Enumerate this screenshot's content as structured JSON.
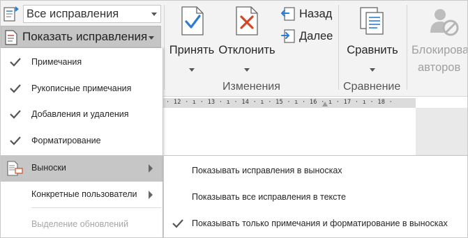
{
  "ribbon": {
    "markup_combo": {
      "value": "Все исправления"
    },
    "show_markup_button": {
      "label": "Показать исправления"
    },
    "accept_button": {
      "label": "Принять"
    },
    "reject_button": {
      "label": "Отклонить"
    },
    "previous_button": {
      "label": "Назад"
    },
    "next_button": {
      "label": "Далее"
    },
    "compare_button": {
      "label": "Сравнить"
    },
    "block_authors_button": {
      "label_line1": "Блокирова",
      "label_line2": "авторов"
    },
    "groups": {
      "changes": "Изменения",
      "compare": "Сравнение"
    }
  },
  "ruler": {
    "text": "· 12 · ı · 13 · ı · 14 · ı · 15 · ı · 16 · ı · 17 · ı · 18 ·"
  },
  "menu": {
    "items": [
      {
        "label": "Примечания",
        "checked": true
      },
      {
        "label": "Рукописные примечания",
        "checked": true
      },
      {
        "label": "Добавления и удаления",
        "checked": true
      },
      {
        "label": "Форматирование",
        "checked": true
      },
      {
        "label": "Выноски",
        "checked": false,
        "highlighted": true,
        "submenu": true,
        "icon": "balloons-icon"
      },
      {
        "label": "Конкретные пользователи",
        "checked": false,
        "submenu": true
      },
      {
        "label": "Выделение обновлений",
        "checked": false,
        "disabled": true
      }
    ]
  },
  "submenu": {
    "items": [
      {
        "label": "Показывать исправления в выносках",
        "checked": false
      },
      {
        "label": "Показывать все исправления в тексте",
        "checked": false
      },
      {
        "label": "Показывать только примечания и форматирование в выносках",
        "checked": true
      }
    ]
  },
  "colors": {
    "accent_blue": "#2b7cd3",
    "reject_red": "#d24726",
    "highlight_gray": "#c6c6c6",
    "ribbon_bg": "#f3f3f3"
  }
}
